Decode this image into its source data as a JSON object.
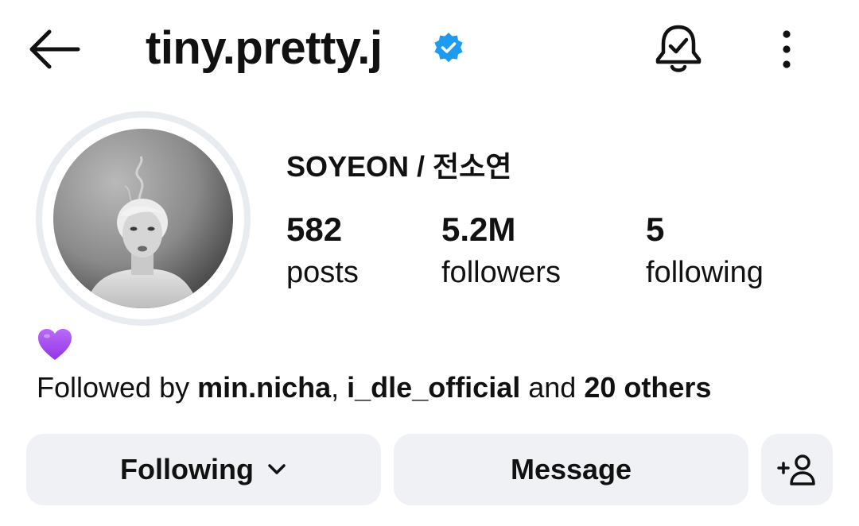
{
  "header": {
    "username": "tiny.pretty.j",
    "back_icon": "arrow-left-icon",
    "verified_icon": "verified-badge-icon",
    "verified_color": "#1d9bf0",
    "notification_icon": "bell-check-icon",
    "more_icon": "vertical-dots-icon"
  },
  "profile": {
    "display_name": "SOYEON / 전소연",
    "stats": [
      {
        "value": "582",
        "label": "posts"
      },
      {
        "value": "5.2M",
        "label": "followers"
      },
      {
        "value": "5",
        "label": "following"
      }
    ],
    "bio_icon": "purple-heart-icon",
    "bio_icon_color": "#a855f7",
    "followed_by": {
      "prefix": "Followed by ",
      "user1": "min.nicha",
      "separator": ", ",
      "user2": "i_dle_official",
      "middle": " and ",
      "others": "20 others"
    }
  },
  "actions": {
    "following_label": "Following",
    "message_label": "Message",
    "add_user_icon": "add-user-icon",
    "button_bg": "#eff1f5"
  }
}
